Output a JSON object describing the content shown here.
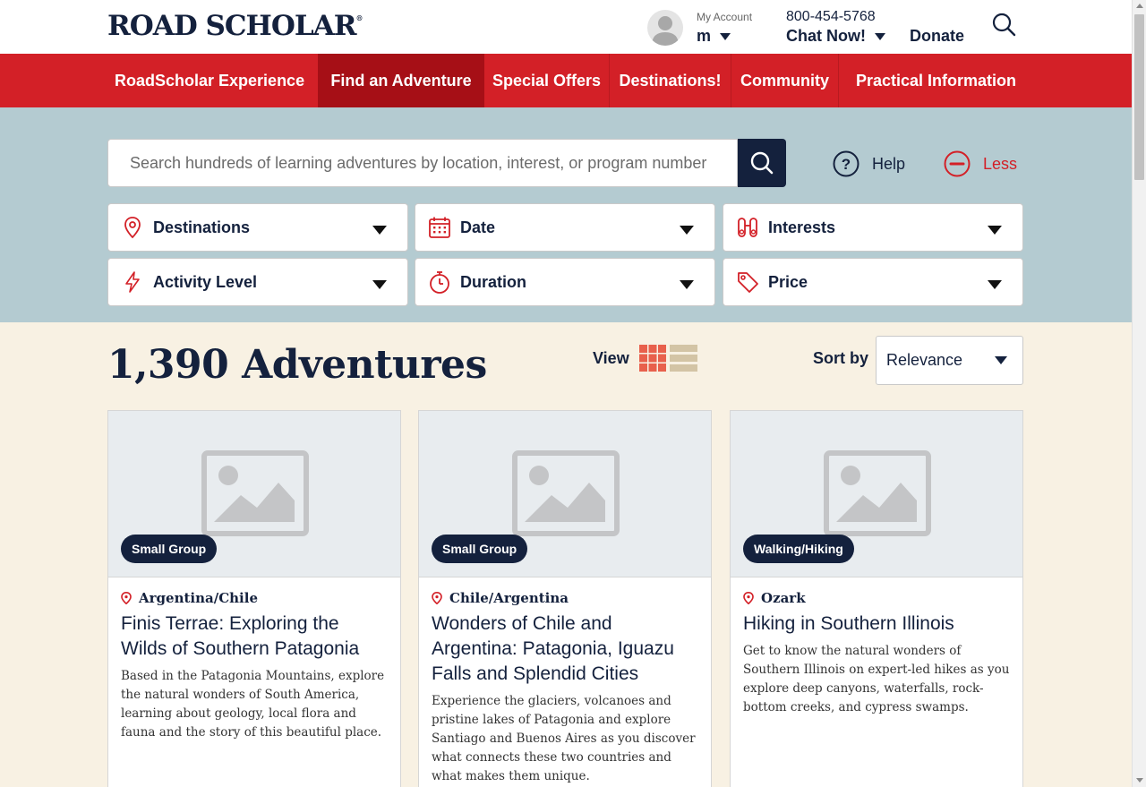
{
  "header": {
    "logo": "ROAD SCHOLAR",
    "logo_mark": "®",
    "account_label": "My Account",
    "account_user": "m",
    "phone": "800-454-5768",
    "chat": "Chat Now!",
    "donate": "Donate"
  },
  "nav": {
    "items": [
      {
        "label": "RoadScholar Experience"
      },
      {
        "label": "Find an Adventure",
        "active": true
      },
      {
        "label": "Special Offers"
      },
      {
        "label": "Destinations!"
      },
      {
        "label": "Community"
      },
      {
        "label": "Practical Information"
      }
    ]
  },
  "search": {
    "placeholder": "Search hundreds of learning adventures by location, interest, or program number",
    "value": "",
    "help_label": "Help",
    "less_label": "Less"
  },
  "filters": [
    {
      "label": "Destinations",
      "icon": "location-pin-icon"
    },
    {
      "label": "Date",
      "icon": "calendar-icon"
    },
    {
      "label": "Interests",
      "icon": "binoculars-icon"
    },
    {
      "label": "Activity Level",
      "icon": "lightning-icon"
    },
    {
      "label": "Duration",
      "icon": "stopwatch-icon"
    },
    {
      "label": "Price",
      "icon": "price-tag-icon"
    }
  ],
  "results": {
    "count": "1,390 Adventures",
    "view_label": "View",
    "sort_label": "Sort by",
    "sort_value": "Relevance"
  },
  "cards": [
    {
      "badge": "Small Group",
      "location": "Argentina/Chile",
      "title": "Finis Terrae: Exploring the Wilds of Southern Patagonia",
      "description": "Based in the Patagonia Mountains, explore the natural wonders of South America, learning about geology, local flora and fauna and the story of this beautiful place."
    },
    {
      "badge": "Small Group",
      "location": "Chile/Argentina",
      "title": "Wonders of Chile and Argentina: Patagonia, Iguazu Falls and Splendid Cities",
      "description": "Experience the glaciers, volcanoes and pristine lakes of Patagonia and explore Santiago and Buenos Aires as you discover what connects these two countries and what makes them unique."
    },
    {
      "badge": "Walking/Hiking",
      "location": "Ozark",
      "title": "Hiking in Southern Illinois",
      "description": "Get to know the natural wonders of Southern Illinois on expert-led hikes as you explore deep canyons, waterfalls, rock-bottom creeks, and cypress swamps."
    }
  ],
  "colors": {
    "brand_red": "#d32027",
    "nav_active": "#a60f16",
    "navy": "#14213d",
    "search_panel": "#b4cbd1",
    "page_bg": "#f8f1e3",
    "grid_icon": "#e8604c",
    "list_icon": "#d3c4a5"
  }
}
